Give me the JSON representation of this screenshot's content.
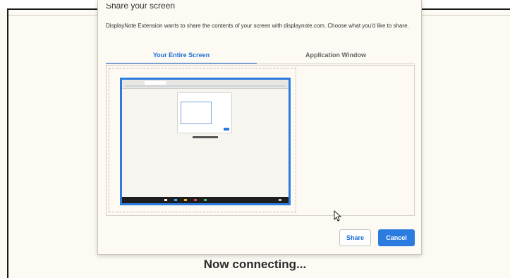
{
  "dialog": {
    "title": "Share your screen",
    "description": "DisplayNote Extension wants to share the contents of your screen with displaynote.com. Choose what you'd like to share.",
    "tabs": [
      {
        "label": "Your Entire Screen",
        "active": true
      },
      {
        "label": "Application Window",
        "active": false
      }
    ],
    "share_label": "Share",
    "cancel_label": "Cancel"
  },
  "status": {
    "message": "Now connecting..."
  },
  "colors": {
    "accent": "#2c7ce0",
    "background": "#fdf9f3",
    "text": "#333333"
  }
}
